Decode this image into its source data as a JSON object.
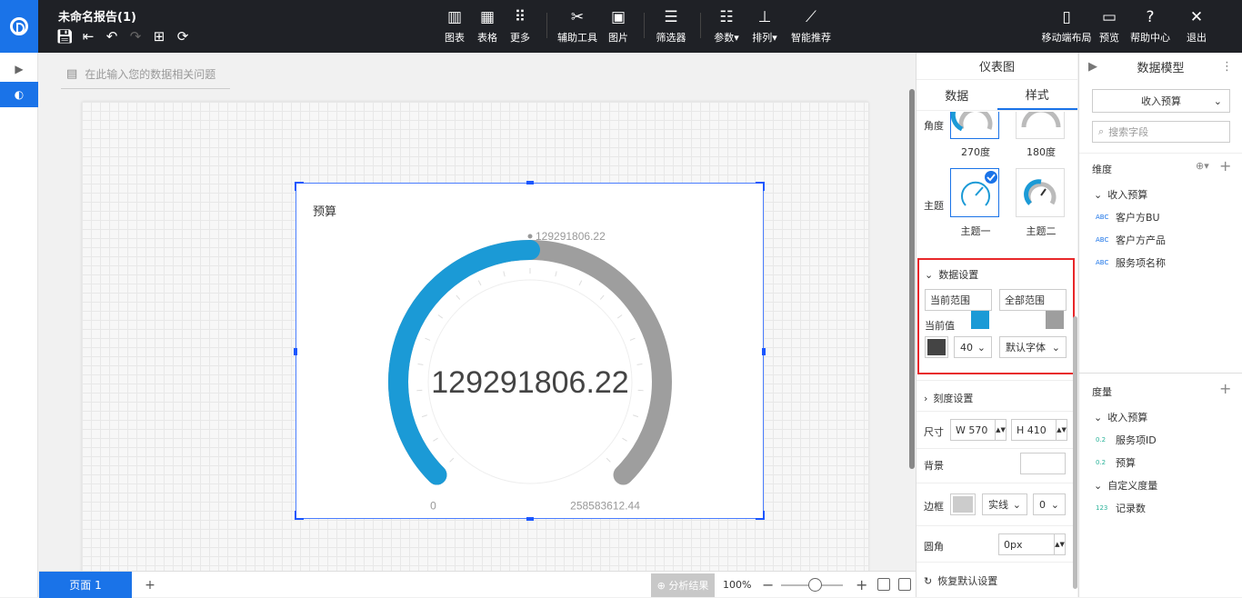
{
  "header": {
    "title": "未命名报告(1)",
    "center_tools": [
      {
        "label": "图表",
        "icon": "bar-chart-icon",
        "glyph": "▥"
      },
      {
        "label": "表格",
        "icon": "table-icon",
        "glyph": "▦"
      },
      {
        "label": "更多",
        "icon": "grid-icon",
        "glyph": "⠿"
      }
    ],
    "tools2": [
      {
        "label": "辅助工具",
        "icon": "tools-icon",
        "glyph": "✂"
      },
      {
        "label": "图片",
        "icon": "image-icon",
        "glyph": "▣"
      }
    ],
    "tools3": [
      {
        "label": "筛选器",
        "icon": "filter-icon",
        "glyph": "☰"
      }
    ],
    "tools4": [
      {
        "label": "参数▾",
        "icon": "params-icon",
        "glyph": "☷"
      },
      {
        "label": "排列▾",
        "icon": "arrange-icon",
        "glyph": "⊥"
      },
      {
        "label": "智能推荐",
        "icon": "smart-recommend-icon",
        "glyph": "⟋"
      }
    ],
    "right_tools": [
      {
        "label": "移动端布局",
        "icon": "mobile-icon",
        "glyph": "▯"
      },
      {
        "label": "预览",
        "icon": "preview-icon",
        "glyph": "▭"
      },
      {
        "label": "帮助中心",
        "icon": "help-icon",
        "glyph": "?"
      },
      {
        "label": "退出",
        "icon": "close-icon",
        "glyph": "✕"
      }
    ]
  },
  "workspace": {
    "ask_placeholder": "在此输入您的数据相关问题"
  },
  "widget": {
    "title": "预算"
  },
  "chart_data": {
    "type": "gauge",
    "title": "预算",
    "value": 129291806.22,
    "min": 0,
    "max": 258583612.44,
    "value_label": "129291806.22",
    "min_label": "0",
    "max_label": "258583612.44",
    "angle": "270度",
    "colors": {
      "current": "#1b9ad6",
      "full": "#9e9e9e"
    }
  },
  "bottom": {
    "page_tab": "页面 1",
    "add": "+",
    "analysis": "分析结果",
    "zoom": "100%"
  },
  "props": {
    "title": "仪表图",
    "tabs": [
      "数据",
      "样式"
    ],
    "angle_label": "角度",
    "angle_opts": [
      "270度",
      "180度"
    ],
    "theme_label": "主题",
    "theme_opts": [
      "主题一",
      "主题二"
    ],
    "data_settings": {
      "title": "数据设置",
      "current_range": "当前范围",
      "full_range": "全部范围",
      "current_value": "当前值",
      "current_color": "#1b9ad6",
      "full_color": "#9e9e9e",
      "font_color": "#444444",
      "font_size": "40",
      "font_family": "默认字体"
    },
    "scale_settings": "刻度设置",
    "size_label": "尺寸",
    "width": "W 570",
    "height": "H 410",
    "bg_label": "背景",
    "border_label": "边框",
    "border_style": "实线",
    "border_width": "0",
    "radius_label": "圆角",
    "radius": "0px",
    "reset": "恢复默认设置"
  },
  "model": {
    "title": "数据模型",
    "dataset": "收入预算",
    "search_placeholder": "搜索字段",
    "dim_title": "维度",
    "dim_group": "收入预算",
    "dims": [
      "客户方BU",
      "客户方产品",
      "服务项名称"
    ],
    "measure_title": "度量",
    "measure_group": "收入预算",
    "measures": [
      "服务项ID",
      "预算"
    ],
    "custom_group": "自定义度量",
    "custom": [
      "记录数"
    ],
    "tag_abc": "ABC",
    "tag_num": "0.2",
    "tag_int": "123"
  }
}
